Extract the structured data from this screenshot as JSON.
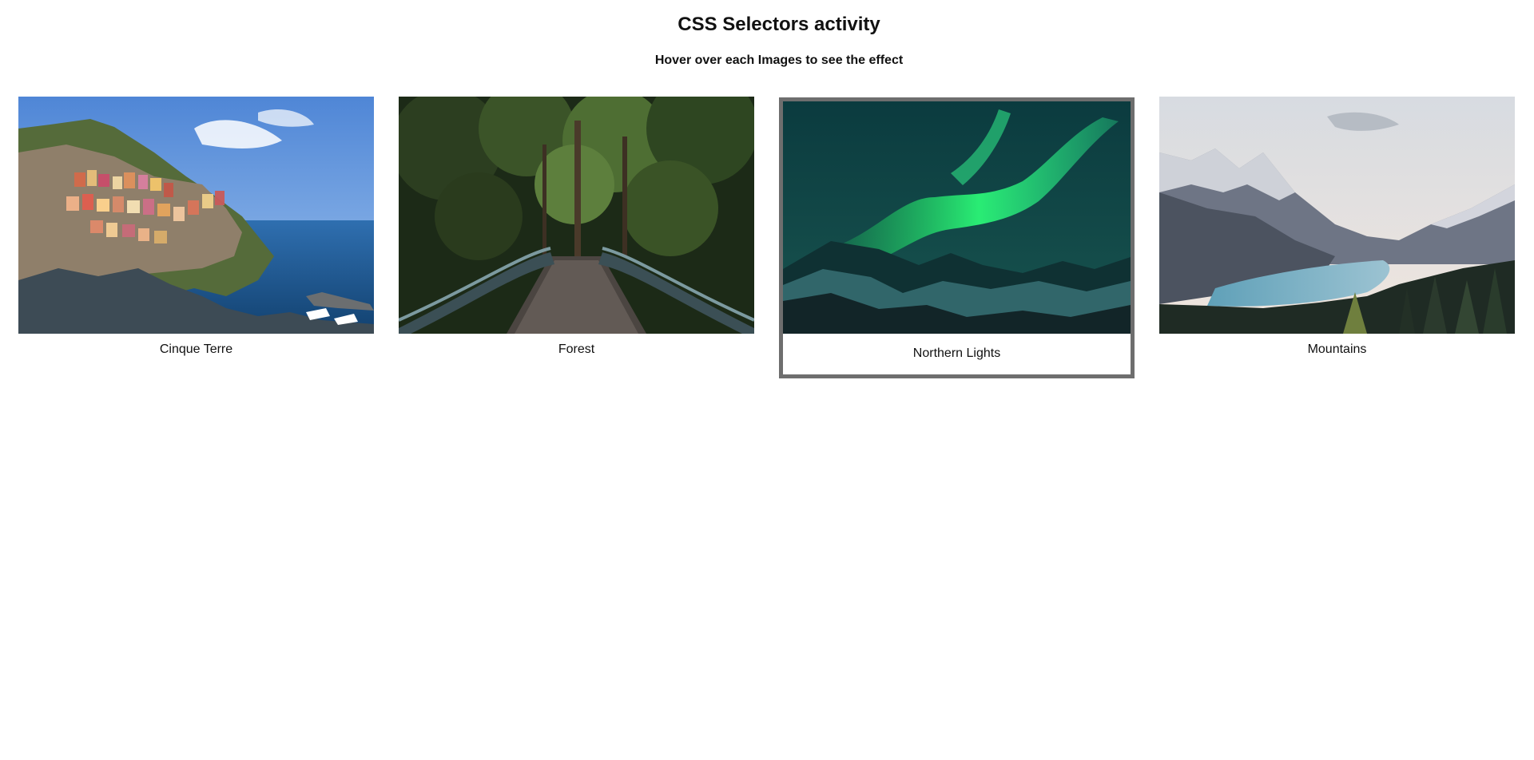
{
  "header": {
    "title": "CSS Selectors activity",
    "subtitle": "Hover over each Images to see the effect"
  },
  "gallery": {
    "items": [
      {
        "caption": "Cinque Terre",
        "image": "coastal-village-photo"
      },
      {
        "caption": "Forest",
        "image": "forest-bridge-photo"
      },
      {
        "caption": "Northern Lights",
        "image": "aurora-photo",
        "state": "hovered"
      },
      {
        "caption": "Mountains",
        "image": "mountain-lake-photo"
      }
    ],
    "hover_border_color": "#6e6e6e"
  }
}
